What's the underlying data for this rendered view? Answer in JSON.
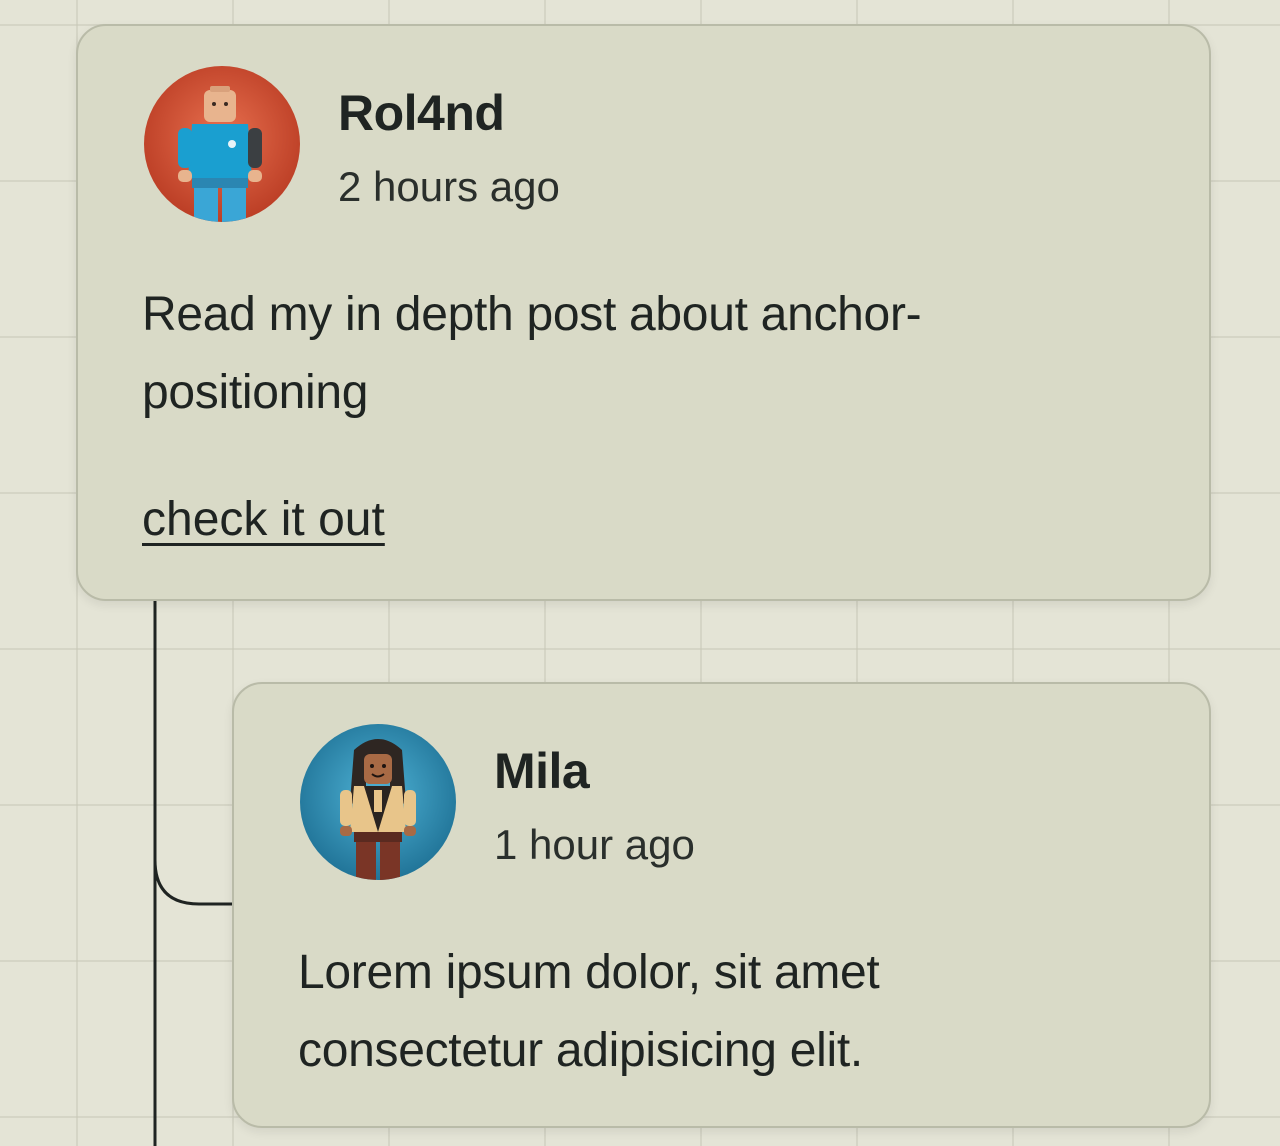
{
  "thread": {
    "post": {
      "author": "Rol4nd",
      "time": "2 hours ago",
      "body": "Read my in depth post about anchor-positioning",
      "link_label": "check it out",
      "avatar_icon": "lego-minifig-avatar",
      "avatar_bg": "#d5553a"
    },
    "reply": {
      "author": "Mila",
      "time": "1 hour ago",
      "body": "Lorem ipsum dolor, sit amet consectetur adipisicing elit.",
      "avatar_icon": "lego-minifig-avatar",
      "avatar_bg": "#2e8fb3"
    }
  },
  "colors": {
    "page_bg": "#e4e4d6",
    "card_bg": "#d9dac7",
    "text": "#1f2422"
  }
}
